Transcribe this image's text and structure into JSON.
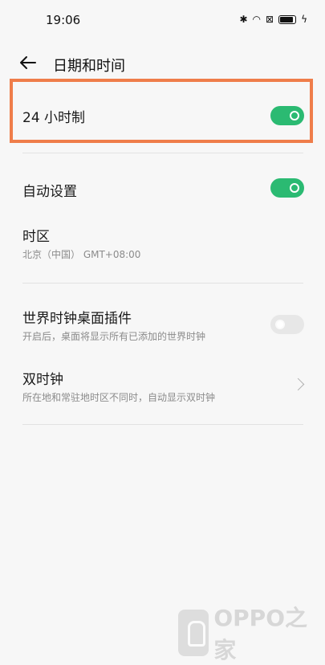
{
  "status_bar": {
    "time": "19:06",
    "icons": [
      "bluetooth-icon",
      "wifi-icon",
      "sim-blocked-icon",
      "battery-icon",
      "charging-icon"
    ]
  },
  "header": {
    "title": "日期和时间"
  },
  "settings": {
    "hour24": {
      "title": "24 小时制",
      "enabled": true
    },
    "auto_set": {
      "title": "自动设置",
      "enabled": true
    },
    "timezone": {
      "title": "时区",
      "subtitle": "北京（中国） GMT+08:00"
    },
    "world_clock_widget": {
      "title": "世界时钟桌面插件",
      "subtitle": "开启后，桌面将显示所有已添加的世界时钟",
      "enabled": false
    },
    "dual_clock": {
      "title": "双时钟",
      "subtitle": "所在地和常驻地时区不同时，自动显示双时钟"
    }
  },
  "colors": {
    "toggle_on": "#2bba72",
    "highlight": "#ef7d4a"
  },
  "watermark": {
    "text": "OPPO之家"
  }
}
